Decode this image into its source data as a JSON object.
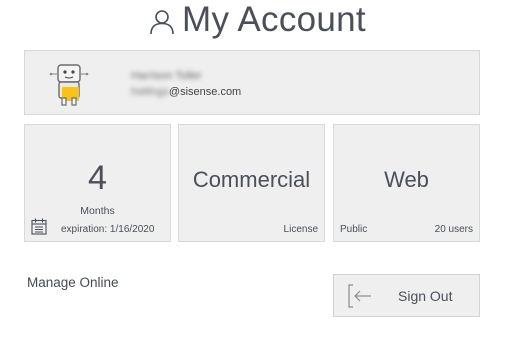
{
  "header": {
    "title": "My Account",
    "icon": "user-icon"
  },
  "profile": {
    "name": "Harrison Toller",
    "email_user": "hsttlngs",
    "email_domain": "@sisense.com",
    "avatar_icon": "robot-avatar",
    "avatar_accent": "#f7c21a"
  },
  "plan": {
    "value": "4",
    "unit": "Months",
    "calendar_icon": "calendar-icon",
    "expiration": "expiration: 1/16/2020"
  },
  "license": {
    "type": "Commercial",
    "caption": "License"
  },
  "web": {
    "label": "Web",
    "visibility": "Public",
    "users": "20 users"
  },
  "actions": {
    "manage_online": "Manage Online",
    "sign_out": "Sign Out",
    "sign_out_icon": "sign-out-icon"
  }
}
